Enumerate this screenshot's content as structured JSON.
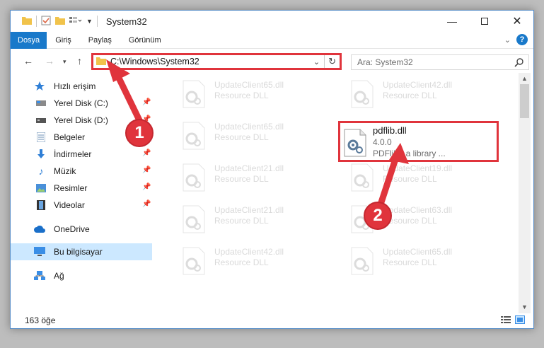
{
  "window": {
    "title": "System32"
  },
  "ribbon": {
    "tabs": [
      "Dosya",
      "Giriş",
      "Paylaş",
      "Görünüm"
    ],
    "help": "?"
  },
  "nav": {
    "address": "C:\\Windows\\System32",
    "search_placeholder": "Ara: System32"
  },
  "sidebar": {
    "items": [
      {
        "label": "Hızlı erişim",
        "icon": "star-icon"
      },
      {
        "label": "Yerel Disk (C:)",
        "icon": "drive-icon",
        "pinned": true
      },
      {
        "label": "Yerel Disk (D:)",
        "icon": "drive-icon",
        "pinned": true
      },
      {
        "label": "Belgeler",
        "icon": "documents-icon",
        "pinned": true
      },
      {
        "label": "İndirmeler",
        "icon": "download-icon",
        "pinned": true
      },
      {
        "label": "Müzik",
        "icon": "music-icon",
        "pinned": true
      },
      {
        "label": "Resimler",
        "icon": "pictures-icon",
        "pinned": true
      },
      {
        "label": "Videolar",
        "icon": "video-icon",
        "pinned": true
      },
      {
        "label": "OneDrive",
        "icon": "cloud-icon"
      },
      {
        "label": "Bu bilgisayar",
        "icon": "computer-icon",
        "selected": true
      },
      {
        "label": "Ağ",
        "icon": "network-icon"
      }
    ]
  },
  "files": [
    {
      "name": "UpdateClient65.dll",
      "desc": "Resource DLL"
    },
    {
      "name": "UpdateClient42.dll",
      "desc": "Resource DLL"
    },
    {
      "name": "UpdateClient65.dll",
      "desc": "Resource DLL"
    },
    {
      "name": "pdflib.dll",
      "version": "4.0.0",
      "desc": "PDFlib - a library ...",
      "highlighted": true
    },
    {
      "name": "UpdateClient21.dll",
      "desc": "Resource DLL"
    },
    {
      "name": "UpdateClient19.dll",
      "desc": "Resource DLL"
    },
    {
      "name": "UpdateClient21.dll",
      "desc": "Resource DLL"
    },
    {
      "name": "UpdateClient63.dll",
      "desc": "Resource DLL"
    },
    {
      "name": "UpdateClient42.dll",
      "desc": "Resource DLL"
    },
    {
      "name": "UpdateClient65.dll",
      "desc": "Resource DLL"
    }
  ],
  "status": {
    "count": "163 öğe"
  },
  "annotations": {
    "step1": "1",
    "step2": "2",
    "color": "#e0343c"
  }
}
